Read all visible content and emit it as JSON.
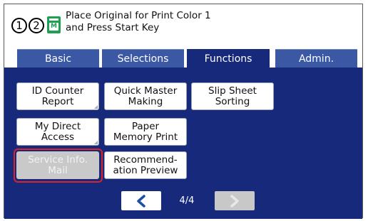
{
  "header": {
    "circle_one": "1",
    "circle_two": "2",
    "machine_icon_letter": "M",
    "message": "Place Original for Print Color 1\nand Press Start Key",
    "icon_color": "#1fa051"
  },
  "tabs": [
    {
      "label": "Basic",
      "active": false
    },
    {
      "label": "Selections",
      "active": false
    },
    {
      "label": "Functions",
      "active": true
    },
    {
      "label": "Admin.",
      "active": false
    }
  ],
  "functions": [
    {
      "label": "ID Counter\nReport",
      "enabled": true
    },
    {
      "label": "Quick Master\nMaking",
      "enabled": true
    },
    {
      "label": "Slip Sheet\nSorting",
      "enabled": true
    },
    {
      "label": "My Direct\nAccess",
      "enabled": true
    },
    {
      "label": "Paper\nMemory Print",
      "enabled": true
    },
    {
      "label": "Service Info.\nMail",
      "enabled": false,
      "highlighted": true
    },
    {
      "label": "Recommend-\nation Preview",
      "enabled": true
    }
  ],
  "pagination": {
    "page_text": "4/4",
    "prev_icon": "chevron-left-icon",
    "next_icon": "chevron-right-icon",
    "next_enabled": false
  },
  "colors": {
    "tab": "#3b58a4",
    "active_tab": "#16297a",
    "highlight": "#d9242a"
  }
}
